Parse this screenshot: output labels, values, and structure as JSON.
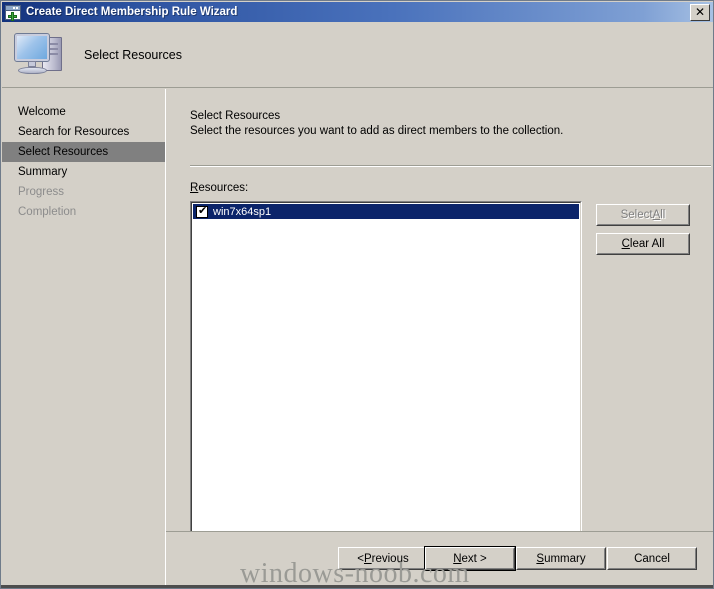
{
  "window": {
    "title": "Create Direct Membership Rule Wizard",
    "icon": "wizard-window-plus-icon",
    "close_label": "✕",
    "titlebar_gradient_start": "#13327c",
    "titlebar_gradient_end": "#a8c2e4",
    "face_color": "#d4d0c8"
  },
  "header": {
    "title": "Select Resources",
    "icon": "computer-monitor-icon"
  },
  "sidebar": {
    "items": [
      {
        "label": "Welcome",
        "state": "normal"
      },
      {
        "label": "Search for Resources",
        "state": "normal"
      },
      {
        "label": "Select Resources",
        "state": "selected"
      },
      {
        "label": "Summary",
        "state": "normal"
      },
      {
        "label": "Progress",
        "state": "disabled"
      },
      {
        "label": "Completion",
        "state": "disabled"
      }
    ],
    "selected_bg": "#808080"
  },
  "main": {
    "heading": "Select Resources",
    "description": "Select the resources you want to add as direct members to the collection.",
    "resources_label_prefix": "R",
    "resources_label_rest": "esources:",
    "list": {
      "rows": [
        {
          "label": "win7x64sp1",
          "checked": true,
          "selected": true
        }
      ],
      "check_glyph": "✔",
      "selection_bg": "#0b246a",
      "selection_fg": "#ffffff"
    },
    "side_buttons": [
      {
        "pre": "Select ",
        "akey": "A",
        "post": "ll",
        "enabled": false
      },
      {
        "pre": "",
        "akey": "C",
        "post": "lear All",
        "enabled": true
      }
    ]
  },
  "footer": {
    "buttons": [
      {
        "pre": "< ",
        "akey": "P",
        "post": "revious",
        "default": false
      },
      {
        "pre": "",
        "akey": "N",
        "post": "ext >",
        "default": true
      },
      {
        "pre": "",
        "akey": "S",
        "post": "ummary",
        "default": false
      },
      {
        "pre": "",
        "akey": "",
        "post": "Cancel",
        "default": false
      }
    ]
  },
  "watermark": {
    "text": "windows-noob.com",
    "color": "#9a9a95"
  }
}
